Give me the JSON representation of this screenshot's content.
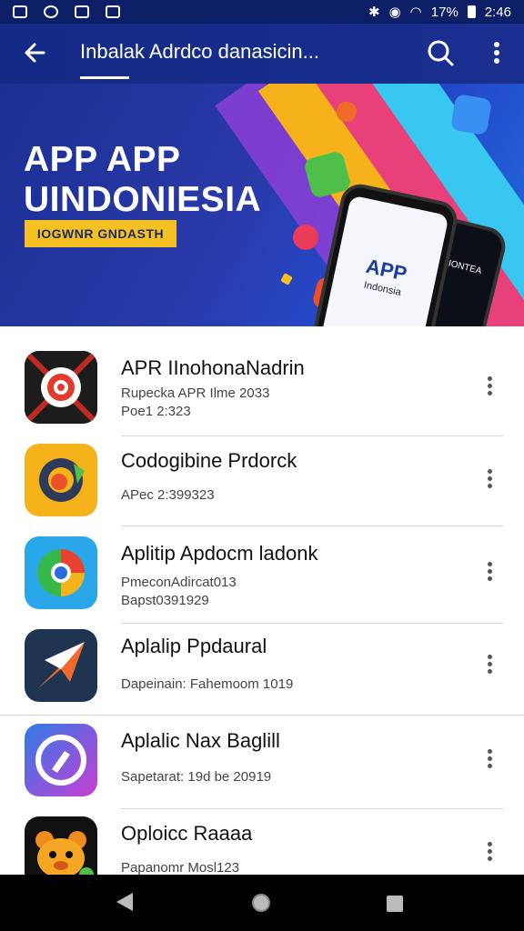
{
  "status_bar": {
    "left_icons": [
      "sim-icon",
      "notification-icon",
      "shield-icon",
      "calendar-icon"
    ],
    "battery_text": "17%",
    "time": "2:46"
  },
  "app_bar": {
    "title": "Inbalak Adrdco danasicin...",
    "back_icon": "arrow-left-icon",
    "search_icon": "search-icon",
    "more_icon": "more-vert-icon"
  },
  "banner": {
    "headline_line1": "APP APP",
    "headline_line2": "UINDONIESIA",
    "tag": "IOGWNR GNDASTH",
    "phone_title": "APP",
    "phone_subtitle": "Indonsia",
    "phone2_text": "ISPRIONTEA"
  },
  "apps": [
    {
      "name": "APR IInohonaNadrin",
      "line1": "Rupecka APR Ilme 2033",
      "line2": "Poe1 2:323",
      "icon": "target-icon",
      "colors": [
        "#1a1a1a",
        "#e23a2c"
      ]
    },
    {
      "name": "Codogibine Prdorck",
      "line1": "APec 2:399323",
      "line2": "",
      "icon": "circle-logo-icon",
      "colors": [
        "#f5b21b",
        "#e8512a"
      ]
    },
    {
      "name": "Aplitip Apdocm ladonk",
      "line1": "PmeconAdircat013",
      "line2": "Bapst0391929",
      "icon": "chrome-like-icon",
      "colors": [
        "#2aa7e8",
        "#36b84a"
      ]
    },
    {
      "name": "Aplalip Ppdaural",
      "line1": "Dapeinain: Fahemoom 1019",
      "line2": "",
      "icon": "plane-icon",
      "colors": [
        "#1e3450",
        "#ef6a2c"
      ]
    },
    {
      "name": "Aplalic Nax Baglill",
      "line1": "Sapetarat: 19d be 20919",
      "line2": "",
      "icon": "compass-icon",
      "colors": [
        "#2f7be8",
        "#c83fd3"
      ]
    },
    {
      "name": "Oploicc Raaaa",
      "line1": "Papanomr Mosl123",
      "line2": "",
      "icon": "bear-icon",
      "colors": [
        "#111111",
        "#f5a623"
      ]
    }
  ],
  "nav_bar": {
    "back": "nav-back-icon",
    "home": "nav-home-icon",
    "recents": "nav-recents-icon"
  }
}
